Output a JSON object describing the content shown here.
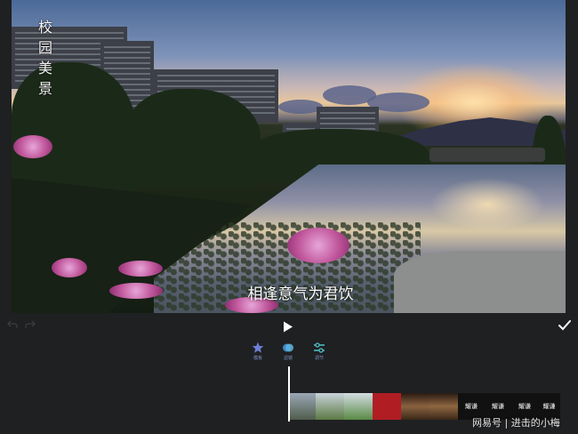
{
  "video_preview": {
    "vertical_title": [
      "校",
      "园",
      "美",
      "景"
    ],
    "caption": "相逢意气为君饮"
  },
  "controls": {
    "undo_icon": "undo-arrow",
    "redo_icon": "redo-arrow",
    "play_icon": "play-triangle",
    "confirm_icon": "checkmark"
  },
  "tools": [
    {
      "label": "模板",
      "icon": "star-icon",
      "color": "#6d7fd8"
    },
    {
      "label": "滤镜",
      "icon": "filter-icon",
      "color": "#5aa6d8"
    },
    {
      "label": "调节",
      "icon": "adjust-icon",
      "color": "#4fc3c8"
    }
  ],
  "timeline": {
    "clips": [
      {
        "text": "",
        "color": "#6a7a8a"
      },
      {
        "text": "",
        "color": "#7a9a6a"
      },
      {
        "text": "",
        "color": "#6d8f5a"
      },
      {
        "text": "",
        "color": "#b01e24"
      },
      {
        "text": "",
        "color": "#5e4632"
      },
      {
        "text": "",
        "color": "#6a4e36"
      },
      {
        "text": "耀谦",
        "color": "#111111"
      },
      {
        "text": "耀谦",
        "color": "#111111"
      },
      {
        "text": "耀谦",
        "color": "#111111"
      },
      {
        "text": "耀谦",
        "color": "#111111"
      }
    ]
  },
  "watermark": "网易号 | 进击的小梅"
}
